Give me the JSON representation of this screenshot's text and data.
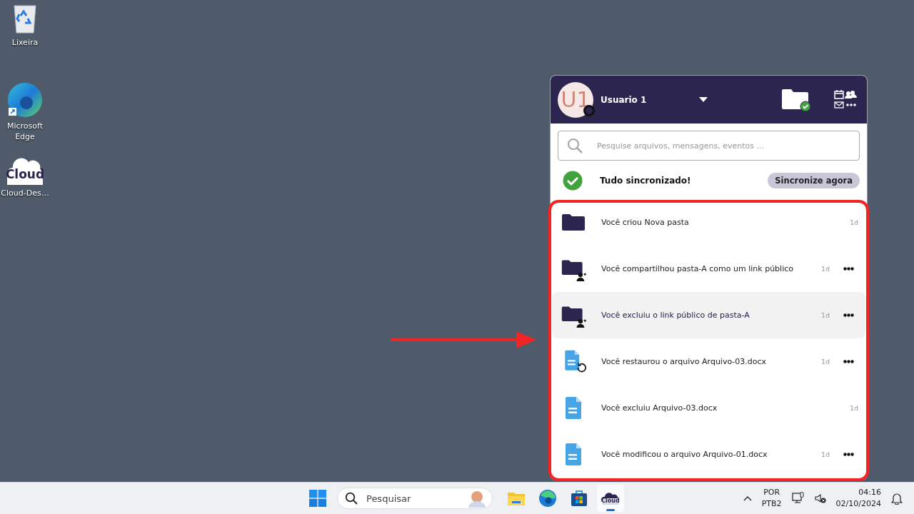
{
  "desktop": {
    "icons": [
      {
        "kind": "recycle-bin",
        "label": "Lixeira"
      },
      {
        "kind": "edge",
        "label": "Microsoft Edge"
      },
      {
        "kind": "cloud",
        "logo_text": "Cloud",
        "label": "Cloud-Des…"
      }
    ]
  },
  "panel": {
    "user": {
      "avatar_initials": "U1",
      "name": "Usuario 1"
    },
    "search": {
      "placeholder": "Pesquise arquivos, mensagens, eventos ..."
    },
    "sync": {
      "status": "Tudo sincronizado!",
      "button": "Sincronize agora"
    },
    "activities": [
      {
        "kind": "folder",
        "text": "Você criou Nova pasta",
        "time": "1d",
        "menu": false,
        "selected": false
      },
      {
        "kind": "folder-share",
        "text": "Você compartilhou pasta-A como um link público",
        "time": "1d",
        "menu": true,
        "selected": false
      },
      {
        "kind": "folder-share",
        "text": "Você excluiu o link público de pasta-A",
        "time": "1d",
        "menu": true,
        "selected": true
      },
      {
        "kind": "file-restore",
        "text": "Você restaurou o arquivo Arquivo-03.docx",
        "time": "1d",
        "menu": true,
        "selected": false
      },
      {
        "kind": "file",
        "text": "Você excluiu Arquivo-03.docx",
        "time": "1d",
        "menu": false,
        "selected": false
      },
      {
        "kind": "file",
        "text": "Você modificou o arquivo Arquivo-01.docx",
        "time": "1d",
        "menu": true,
        "selected": false
      }
    ]
  },
  "annotations": {
    "highlight_box": true,
    "arrow": true
  },
  "taskbar": {
    "search_placeholder": "Pesquisar",
    "apps": [
      {
        "kind": "explorer",
        "active": false
      },
      {
        "kind": "edge",
        "active": false
      },
      {
        "kind": "store",
        "active": false
      },
      {
        "kind": "cloud",
        "logo_text": "Cloud",
        "active": true
      }
    ],
    "tray": {
      "language": "POR",
      "layout": "PTB2",
      "time": "04:16",
      "date": "02/10/2024"
    }
  }
}
